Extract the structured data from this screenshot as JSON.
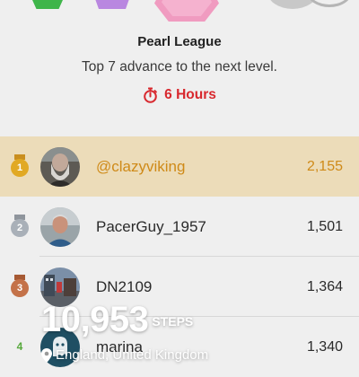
{
  "colors": {
    "accent_gold": "#cf8a18",
    "timer_red": "#d8282e",
    "highlight_bg": "#ecdcb9",
    "rank4_green": "#56a83b"
  },
  "league": {
    "title": "Pearl League",
    "subtitle": "Top 7 advance to the next level.",
    "timer_icon": "stopwatch-icon",
    "timer_text": "6 Hours"
  },
  "leaderboard": [
    {
      "rank": "1",
      "rank_icon": "gold-medal-icon",
      "name": "@clazyviking",
      "score": "2,155",
      "highlighted": true
    },
    {
      "rank": "2",
      "rank_icon": "silver-medal-icon",
      "name": "PacerGuy_1957",
      "score": "1,501",
      "highlighted": false
    },
    {
      "rank": "3",
      "rank_icon": "bronze-medal-icon",
      "name": "DN2109",
      "score": "1,364",
      "highlighted": false
    },
    {
      "rank": "4",
      "rank_icon": "",
      "name": "marina",
      "score": "1,340",
      "highlighted": false
    }
  ],
  "overlay": {
    "steps_value": "10,953",
    "steps_label": "STEPS",
    "location_icon": "location-pin-icon",
    "location_text": "England, United Kingdom"
  }
}
